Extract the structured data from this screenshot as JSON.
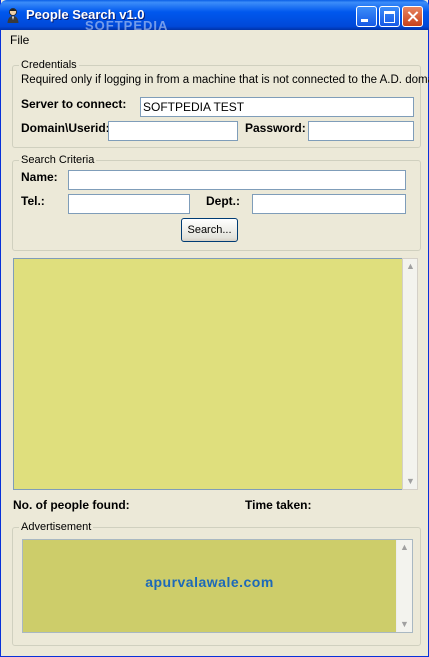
{
  "window": {
    "title": "People Search v1.0",
    "watermark": "SOFTPEDIA"
  },
  "menu": {
    "file": "File"
  },
  "credentials": {
    "legend": "Credentials",
    "note": "Required only if logging in from a machine that is not connected to the A.D. domain.",
    "server_label": "Server to connect:",
    "server_value": "SOFTPEDIA TEST",
    "domain_label": "Domain\\Userid:",
    "domain_value": "",
    "password_label": "Password:",
    "password_value": ""
  },
  "search": {
    "legend": "Search Criteria",
    "name_label": "Name:",
    "name_value": "",
    "tel_label": "Tel.:",
    "tel_value": "",
    "dept_label": "Dept.:",
    "dept_value": "",
    "button_label": "Search..."
  },
  "status": {
    "found_label": "No. of people found:",
    "time_label": "Time taken:"
  },
  "advertisement": {
    "legend": "Advertisement",
    "text": "apurvalawale.com"
  },
  "colors": {
    "results_bg": "#dfdf7d",
    "ad_bg": "#cdcd6a",
    "ad_text": "#1c69b8"
  }
}
